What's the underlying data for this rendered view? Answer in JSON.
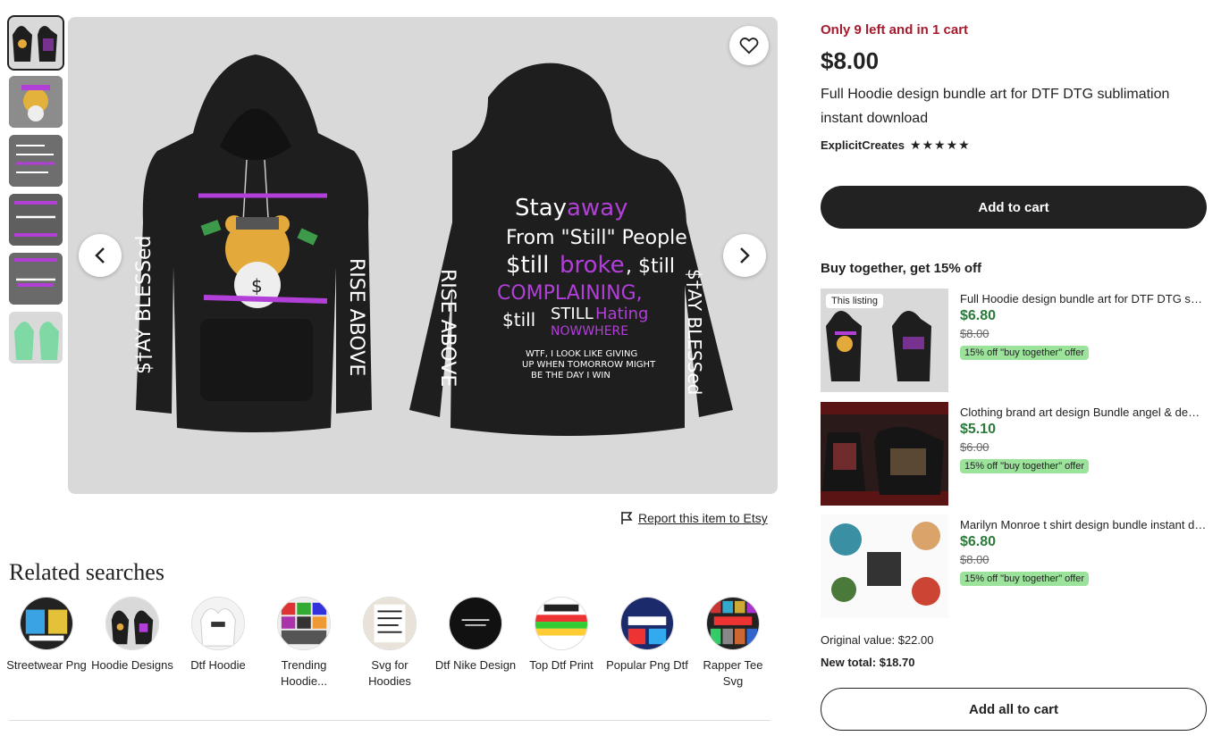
{
  "gallery": {
    "thumbnails": [
      "hoodie-front-back",
      "bear-design",
      "stay-away-text",
      "rise-above",
      "tipsy-blessed",
      "green-hoodie"
    ],
    "favorite_icon": "heart-icon",
    "prev_icon": "chevron-left-icon",
    "next_icon": "chevron-right-icon"
  },
  "report_link": "Report this item to Etsy",
  "related": {
    "title": "Related searches",
    "items": [
      {
        "label": "Streetwear Png"
      },
      {
        "label": "Hoodie Designs"
      },
      {
        "label": "Dtf Hoodie"
      },
      {
        "label": "Trending Hoodie..."
      },
      {
        "label": "Svg for Hoodies"
      },
      {
        "label": "Dtf Nike Design"
      },
      {
        "label": "Top Dtf Print"
      },
      {
        "label": "Popular Png Dtf"
      },
      {
        "label": "Rapper Tee Svg"
      }
    ]
  },
  "product": {
    "stock_note": "Only 9 left and in 1 cart",
    "price": "$8.00",
    "title": "Full Hoodie design bundle art for DTF DTG sublimation instant download",
    "shop": "ExplicitCreates",
    "stars": "★★★★★",
    "add_to_cart": "Add to cart"
  },
  "bundle": {
    "title": "Buy together, get 15% off",
    "this_listing_tag": "This listing",
    "items": [
      {
        "name": "Full Hoodie design bundle art for DTF DTG sublimation instant download",
        "price": "$6.80",
        "old_price": "$8.00",
        "offer": "15% off \"buy together\" offer"
      },
      {
        "name": "Clothing brand art design Bundle angel & demon",
        "price": "$5.10",
        "old_price": "$6.00",
        "offer": "15% off \"buy together\" offer"
      },
      {
        "name": "Marilyn Monroe t shirt design bundle instant download",
        "price": "$6.80",
        "old_price": "$8.00",
        "offer": "15% off \"buy together\" offer"
      }
    ],
    "original_value": "Original value: $22.00",
    "new_total": "New total: $18.70",
    "add_all": "Add all to cart"
  },
  "colors": {
    "stock": "#a61a2e",
    "bundle_price": "#2b7a3b",
    "offer_badge": "#9be39b",
    "accent_purple": "#b13fd8"
  }
}
